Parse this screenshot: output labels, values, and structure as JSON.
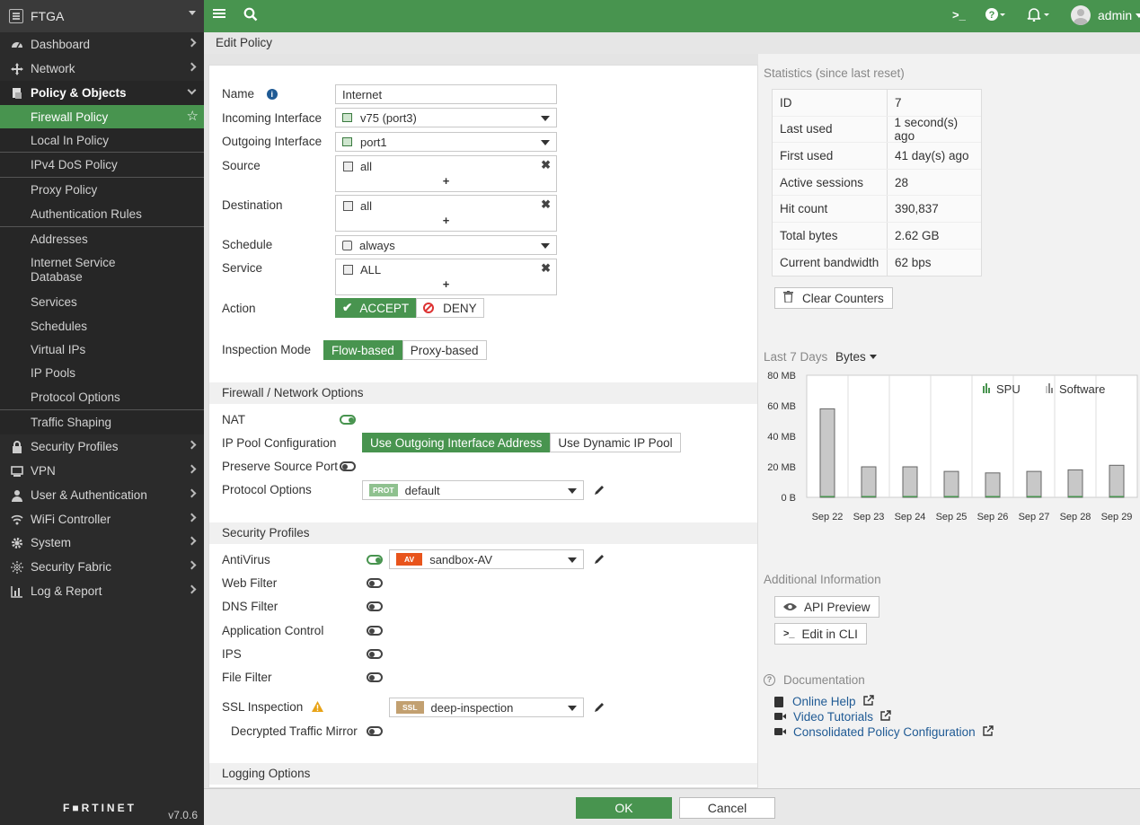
{
  "app": {
    "device_name": "FTGA",
    "brand": "F■RTINET",
    "version": "v7.0.6"
  },
  "topbar": {
    "user": "admin"
  },
  "breadcrumb": "Edit Policy",
  "sidebar": {
    "nav": [
      {
        "label": "Dashboard",
        "icon": "dashboard-icon"
      },
      {
        "label": "Network",
        "icon": "network-icon"
      },
      {
        "label": "Policy & Objects",
        "icon": "policy-icon"
      },
      {
        "label": "Security Profiles",
        "icon": "lock-icon"
      },
      {
        "label": "VPN",
        "icon": "monitor-icon"
      },
      {
        "label": "User & Authentication",
        "icon": "user-icon"
      },
      {
        "label": "WiFi Controller",
        "icon": "wifi-icon"
      },
      {
        "label": "System",
        "icon": "gear-icon"
      },
      {
        "label": "Security Fabric",
        "icon": "fabric-icon"
      },
      {
        "label": "Log & Report",
        "icon": "chart-icon"
      }
    ],
    "sub": [
      "Firewall Policy",
      "Local In Policy",
      "IPv4 DoS Policy",
      "Proxy Policy",
      "Authentication Rules",
      "Addresses",
      "Internet Service Database",
      "Services",
      "Schedules",
      "Virtual IPs",
      "IP Pools",
      "Protocol Options",
      "Traffic Shaping"
    ]
  },
  "form": {
    "name_label": "Name",
    "name_value": "Internet",
    "incoming_label": "Incoming Interface",
    "incoming_value": "v75 (port3)",
    "outgoing_label": "Outgoing Interface",
    "outgoing_value": "port1",
    "source_label": "Source",
    "source_value": "all",
    "destination_label": "Destination",
    "destination_value": "all",
    "schedule_label": "Schedule",
    "schedule_value": "always",
    "service_label": "Service",
    "service_value": "ALL",
    "action_label": "Action",
    "accept": "ACCEPT",
    "deny": "DENY",
    "inspection_label": "Inspection Mode",
    "flow": "Flow-based",
    "proxy": "Proxy-based",
    "plus": "+",
    "remove": "✖"
  },
  "firewall": {
    "section": "Firewall / Network Options",
    "nat_label": "NAT",
    "ippool_label": "IP Pool Configuration",
    "use_outgoing": "Use Outgoing Interface Address",
    "use_dynamic": "Use Dynamic IP Pool",
    "preserve_label": "Preserve Source Port",
    "protocol_label": "Protocol Options",
    "protocol_tag": "PROT",
    "protocol_value": "default"
  },
  "security": {
    "section": "Security Profiles",
    "antivirus": "AntiVirus",
    "av_tag": "AV",
    "av_value": "sandbox-AV",
    "webfilter": "Web Filter",
    "dnsfilter": "DNS Filter",
    "appcontrol": "Application Control",
    "ips": "IPS",
    "filefilter": "File Filter",
    "ssl_label": "SSL Inspection",
    "ssl_tag": "SSL",
    "ssl_value": "deep-inspection",
    "mirror_label": "Decrypted Traffic Mirror"
  },
  "logging": {
    "section": "Logging Options"
  },
  "stats": {
    "title": "Statistics (since last reset)",
    "rows": [
      {
        "k": "ID",
        "v": "7"
      },
      {
        "k": "Last used",
        "v": "1 second(s) ago"
      },
      {
        "k": "First used",
        "v": "41 day(s) ago"
      },
      {
        "k": "Active sessions",
        "v": "28"
      },
      {
        "k": "Hit count",
        "v": "390,837"
      },
      {
        "k": "Total bytes",
        "v": "2.62 GB"
      },
      {
        "k": "Current bandwidth",
        "v": "62 bps"
      }
    ],
    "clear": "Clear Counters"
  },
  "chart_label": {
    "period": "Last 7 Days",
    "unit": "Bytes"
  },
  "chart_data": {
    "type": "bar",
    "categories": [
      "Sep 22",
      "Sep 23",
      "Sep 24",
      "Sep 25",
      "Sep 26",
      "Sep 27",
      "Sep 28",
      "Sep 29"
    ],
    "series": [
      {
        "name": "SPU",
        "values": [
          0,
          0,
          0,
          0,
          0,
          0,
          0,
          0
        ],
        "color": "#48944f"
      },
      {
        "name": "Software",
        "values": [
          58,
          20,
          20,
          17,
          16,
          17,
          18,
          21
        ],
        "color": "#c8c8c8"
      }
    ],
    "yticks": [
      "80 MB",
      "60 MB",
      "40 MB",
      "20 MB",
      "0 B"
    ],
    "ylim": [
      0,
      80
    ],
    "legend_position": "top-right"
  },
  "additional": {
    "title": "Additional Information",
    "api": "API Preview",
    "cli": "Edit in CLI"
  },
  "docs": {
    "title": "Documentation",
    "online": "Online Help",
    "video": "Video Tutorials",
    "consolidated": "Consolidated Policy Configuration"
  },
  "footer": {
    "ok": "OK",
    "cancel": "Cancel"
  }
}
